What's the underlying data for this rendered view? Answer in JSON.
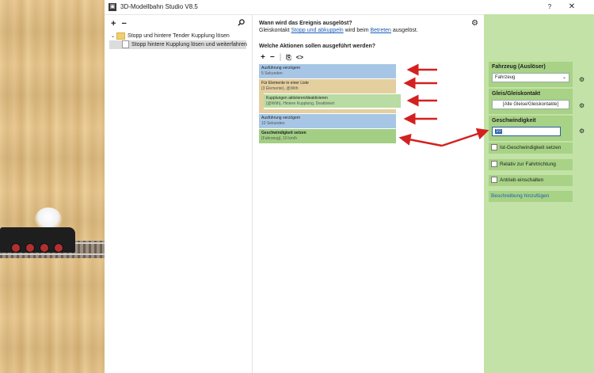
{
  "window": {
    "title": "3D-Modellbahn Studio V8.5",
    "help": "?",
    "close": "✕"
  },
  "tree": {
    "add": "+",
    "remove": "−",
    "search_icon": "search-icon",
    "items": [
      {
        "label": "Stopp und hintere Tender Kupplung lösen",
        "type": "folder"
      },
      {
        "label": "Stopp hintere Kupplung lösen und weiterfahren",
        "type": "event",
        "selected": true
      }
    ]
  },
  "event": {
    "question": "Wann wird das Ereignis ausgelöst?",
    "prefix": "Gleiskontakt ",
    "link1": "Stopp und abkuppeln",
    "middle": " wird beim ",
    "link2": "Betreten",
    "suffix": " ausgelöst."
  },
  "actions": {
    "question": "Welche Aktionen sollen ausgeführt werden?",
    "toolbar": [
      "+",
      "−",
      "⎘",
      "<>"
    ],
    "items": [
      {
        "title": "Ausführung verzögern",
        "sub": "5 Sekunden",
        "color": "#a7c6e6"
      },
      {
        "title": "Für Elemente in einer Liste",
        "sub": "{3 Elemente}, @With",
        "color": "#e4cf9e"
      },
      {
        "title": "Kupplungen aktivieren/deaktivieren",
        "sub": "{@With}, Hintere Kupplung, Deaktiviert",
        "color": "#b8dca3"
      },
      {
        "title": "Ausführung verzögern",
        "sub": "10 Sekunden",
        "color": "#a7c6e6"
      },
      {
        "title": "Geschwindigkeit setzen",
        "sub": "{Fahrzeug}, 10 km/h",
        "color": "#a2cf84"
      }
    ]
  },
  "props": {
    "vehicle_title": "Fahrzeug (Auslöser)",
    "vehicle_value": "Fahrzeug",
    "track_title": "Gleis/Gleiskontakt",
    "track_value": "[Alle Gleise/Gleiskontakte]",
    "speed_title": "Geschwindigkeit",
    "speed_value": "10",
    "check1": "Ist-Geschwindigkeit setzen",
    "check2": "Relativ zur Fahrtrichtung",
    "check3": "Antrieb einschalten",
    "desc": "Beschreibung hinzufügen"
  },
  "colors": {
    "arrow": "#d42020",
    "panel_green": "#c3e2a7",
    "group_green": "#a8d285"
  }
}
